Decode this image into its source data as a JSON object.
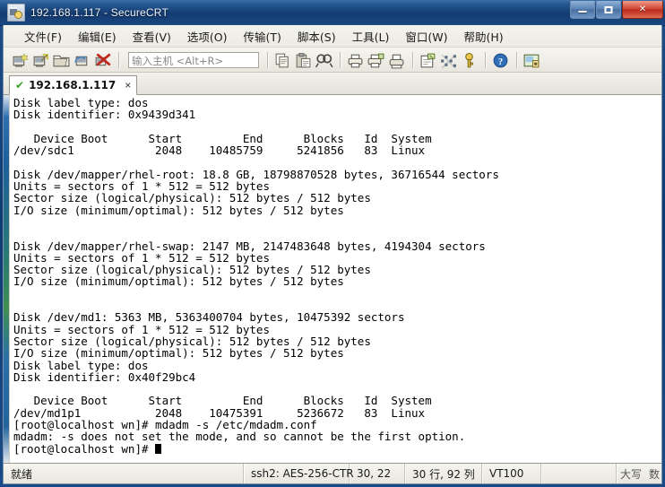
{
  "window": {
    "title": "192.168.1.117 - SecureCRT",
    "icon": "securecrt-app-icon",
    "controls": {
      "minimize": "minimize-button",
      "restore": "restore-button",
      "close": "close-button",
      "close_glyph": "✕"
    }
  },
  "menubar": {
    "items": [
      {
        "label": "文件(F)",
        "name": "menu-file"
      },
      {
        "label": "编辑(E)",
        "name": "menu-edit"
      },
      {
        "label": "查看(V)",
        "name": "menu-view"
      },
      {
        "label": "选项(O)",
        "name": "menu-options"
      },
      {
        "label": "传输(T)",
        "name": "menu-transfer"
      },
      {
        "label": "脚本(S)",
        "name": "menu-script"
      },
      {
        "label": "工具(L)",
        "name": "menu-tools"
      },
      {
        "label": "窗口(W)",
        "name": "menu-window"
      },
      {
        "label": "帮助(H)",
        "name": "menu-help"
      }
    ]
  },
  "toolbar": {
    "host_input": {
      "value": "",
      "placeholder": "输入主机 <Alt+R>"
    },
    "icons": [
      "new-session-icon",
      "clone-session-icon",
      "open-session-folder-icon",
      "reconnect-icon",
      "disconnect-icon",
      "copy-icon",
      "paste-icon",
      "find-icon",
      "print-icon",
      "print-selection-icon",
      "printer-icon",
      "log-session-icon",
      "transfer-settings-icon",
      "key-icon",
      "help-icon",
      "session-options-icon"
    ]
  },
  "tabs": [
    {
      "label": "192.168.1.117",
      "status_icon": "connected-check-icon",
      "check_glyph": "✔",
      "close_glyph": "×",
      "active": true
    }
  ],
  "terminal": {
    "lines": [
      "Disk label type: dos",
      "Disk identifier: 0x9439d341",
      "",
      "   Device Boot      Start         End      Blocks   Id  System",
      "/dev/sdc1            2048    10485759     5241856   83  Linux",
      "",
      "Disk /dev/mapper/rhel-root: 18.8 GB, 18798870528 bytes, 36716544 sectors",
      "Units = sectors of 1 * 512 = 512 bytes",
      "Sector size (logical/physical): 512 bytes / 512 bytes",
      "I/O size (minimum/optimal): 512 bytes / 512 bytes",
      "",
      "",
      "Disk /dev/mapper/rhel-swap: 2147 MB, 2147483648 bytes, 4194304 sectors",
      "Units = sectors of 1 * 512 = 512 bytes",
      "Sector size (logical/physical): 512 bytes / 512 bytes",
      "I/O size (minimum/optimal): 512 bytes / 512 bytes",
      "",
      "",
      "Disk /dev/md1: 5363 MB, 5363400704 bytes, 10475392 sectors",
      "Units = sectors of 1 * 512 = 512 bytes",
      "Sector size (logical/physical): 512 bytes / 512 bytes",
      "I/O size (minimum/optimal): 512 bytes / 512 bytes",
      "Disk label type: dos",
      "Disk identifier: 0x40f29bc4",
      "",
      "   Device Boot      Start         End      Blocks   Id  System",
      "/dev/md1p1           2048    10475391     5236672   83  Linux",
      "[root@localhost wn]# mdadm -s /etc/mdadm.conf",
      "mdadm: -s does not set the mode, and so cannot be the first option.",
      "[root@localhost wn]# "
    ],
    "cursor": "block"
  },
  "statusbar": {
    "ready": "就绪",
    "cipher": "ssh2: AES-256-CTR",
    "position": "30, 22",
    "size": "30 行, 92 列",
    "emulation": "VT100",
    "caps": "大写",
    "num": "数"
  },
  "colors": {
    "titlebar_start": "#3e6ea8",
    "titlebar_end": "#1a4881",
    "close_button": "#d0432f",
    "terminal_bg": "#ffffff",
    "terminal_fg": "#000000",
    "tab_check": "#3aa02a",
    "chrome_bg": "#f0efe9"
  }
}
